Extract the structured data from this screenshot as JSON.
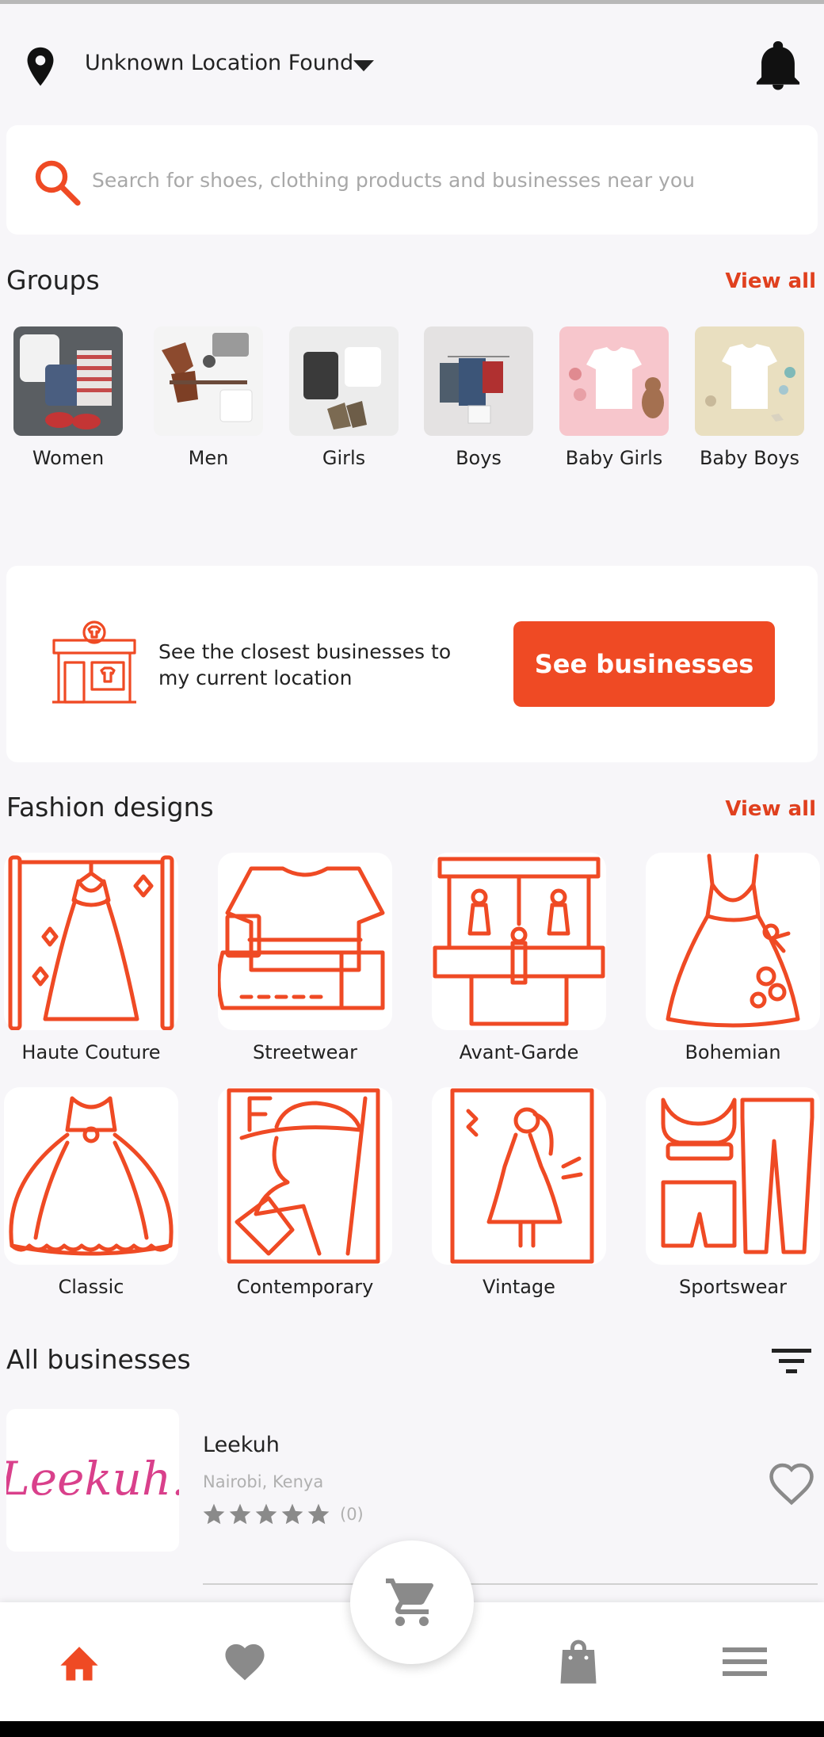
{
  "location": {
    "label": "Unknown Location Found",
    "icon": "location-pin-icon"
  },
  "search": {
    "placeholder": "Search for shoes, clothing products and businesses near you",
    "value": ""
  },
  "groups": {
    "title": "Groups",
    "view_all": "View all",
    "items": [
      {
        "label": "Women"
      },
      {
        "label": "Men"
      },
      {
        "label": "Girls"
      },
      {
        "label": "Boys"
      },
      {
        "label": "Baby Girls"
      },
      {
        "label": "Baby Boys"
      }
    ]
  },
  "promo": {
    "text": "See the closest businesses to my current location",
    "button": "See businesses"
  },
  "designs": {
    "title": "Fashion designs",
    "view_all": "View all",
    "items": [
      {
        "label": "Haute Couture"
      },
      {
        "label": "Streetwear"
      },
      {
        "label": "Avant-Garde"
      },
      {
        "label": "Bohemian"
      },
      {
        "label": "Classic"
      },
      {
        "label": "Contemporary"
      },
      {
        "label": "Vintage"
      },
      {
        "label": "Sportswear"
      }
    ]
  },
  "businesses": {
    "title": "All businesses",
    "items": [
      {
        "name": "Leekuh",
        "location": "Nairobi, Kenya",
        "rating_count": "(0)",
        "logo_text": "Leekuh.",
        "rating": 0
      }
    ]
  },
  "colors": {
    "accent": "#ef4a24",
    "background": "#f7f6f9",
    "icon_gray": "#8a8a8a"
  },
  "nav": [
    "home-icon",
    "heart-icon",
    "cart-icon",
    "shopping-bag-icon",
    "menu-icon"
  ]
}
